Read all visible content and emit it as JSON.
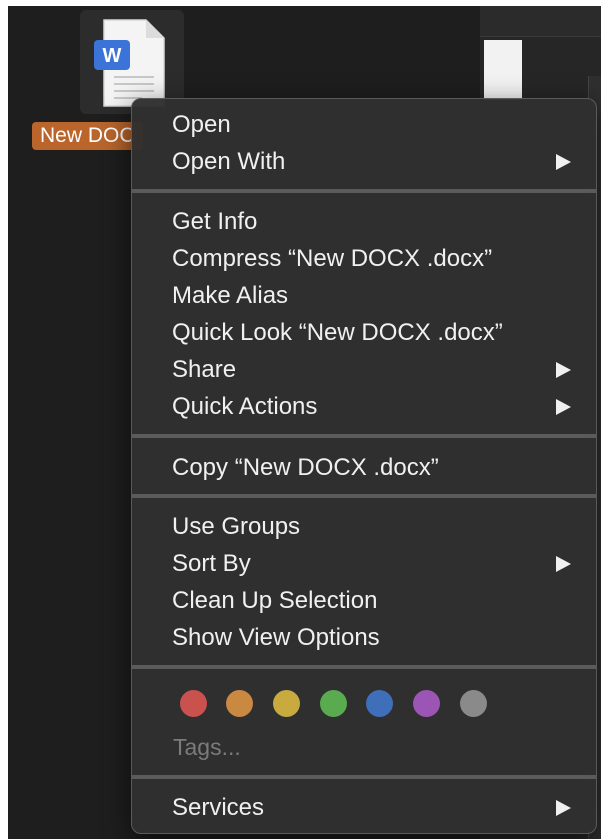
{
  "desktop_file": {
    "label": "New DOC",
    "icon": "word-document-icon",
    "badge_letter": "W"
  },
  "context_menu": {
    "group1": [
      {
        "label": "Open",
        "has_submenu": false
      },
      {
        "label": "Open With",
        "has_submenu": true
      }
    ],
    "group2": [
      {
        "label": "Get Info",
        "has_submenu": false
      },
      {
        "label": "Compress “New DOCX .docx”",
        "has_submenu": false
      },
      {
        "label": "Make Alias",
        "has_submenu": false
      },
      {
        "label": "Quick Look “New DOCX .docx”",
        "has_submenu": false
      },
      {
        "label": "Share",
        "has_submenu": true
      },
      {
        "label": "Quick Actions",
        "has_submenu": true
      }
    ],
    "group3": [
      {
        "label": "Copy “New DOCX .docx”",
        "has_submenu": false
      }
    ],
    "group4": [
      {
        "label": "Use Groups",
        "has_submenu": false
      },
      {
        "label": "Sort By",
        "has_submenu": true
      },
      {
        "label": "Clean Up Selection",
        "has_submenu": false
      },
      {
        "label": "Show View Options",
        "has_submenu": false
      }
    ],
    "tags": {
      "colors": [
        {
          "name": "red",
          "hex": "#c9524f"
        },
        {
          "name": "orange",
          "hex": "#c98942"
        },
        {
          "name": "yellow",
          "hex": "#c8aa3e"
        },
        {
          "name": "green",
          "hex": "#5aab4f"
        },
        {
          "name": "blue",
          "hex": "#3f6fb8"
        },
        {
          "name": "purple",
          "hex": "#9a55b5"
        },
        {
          "name": "gray",
          "hex": "#8a8a8a"
        }
      ],
      "placeholder": "Tags..."
    },
    "group5": [
      {
        "label": "Services",
        "has_submenu": true
      }
    ]
  }
}
